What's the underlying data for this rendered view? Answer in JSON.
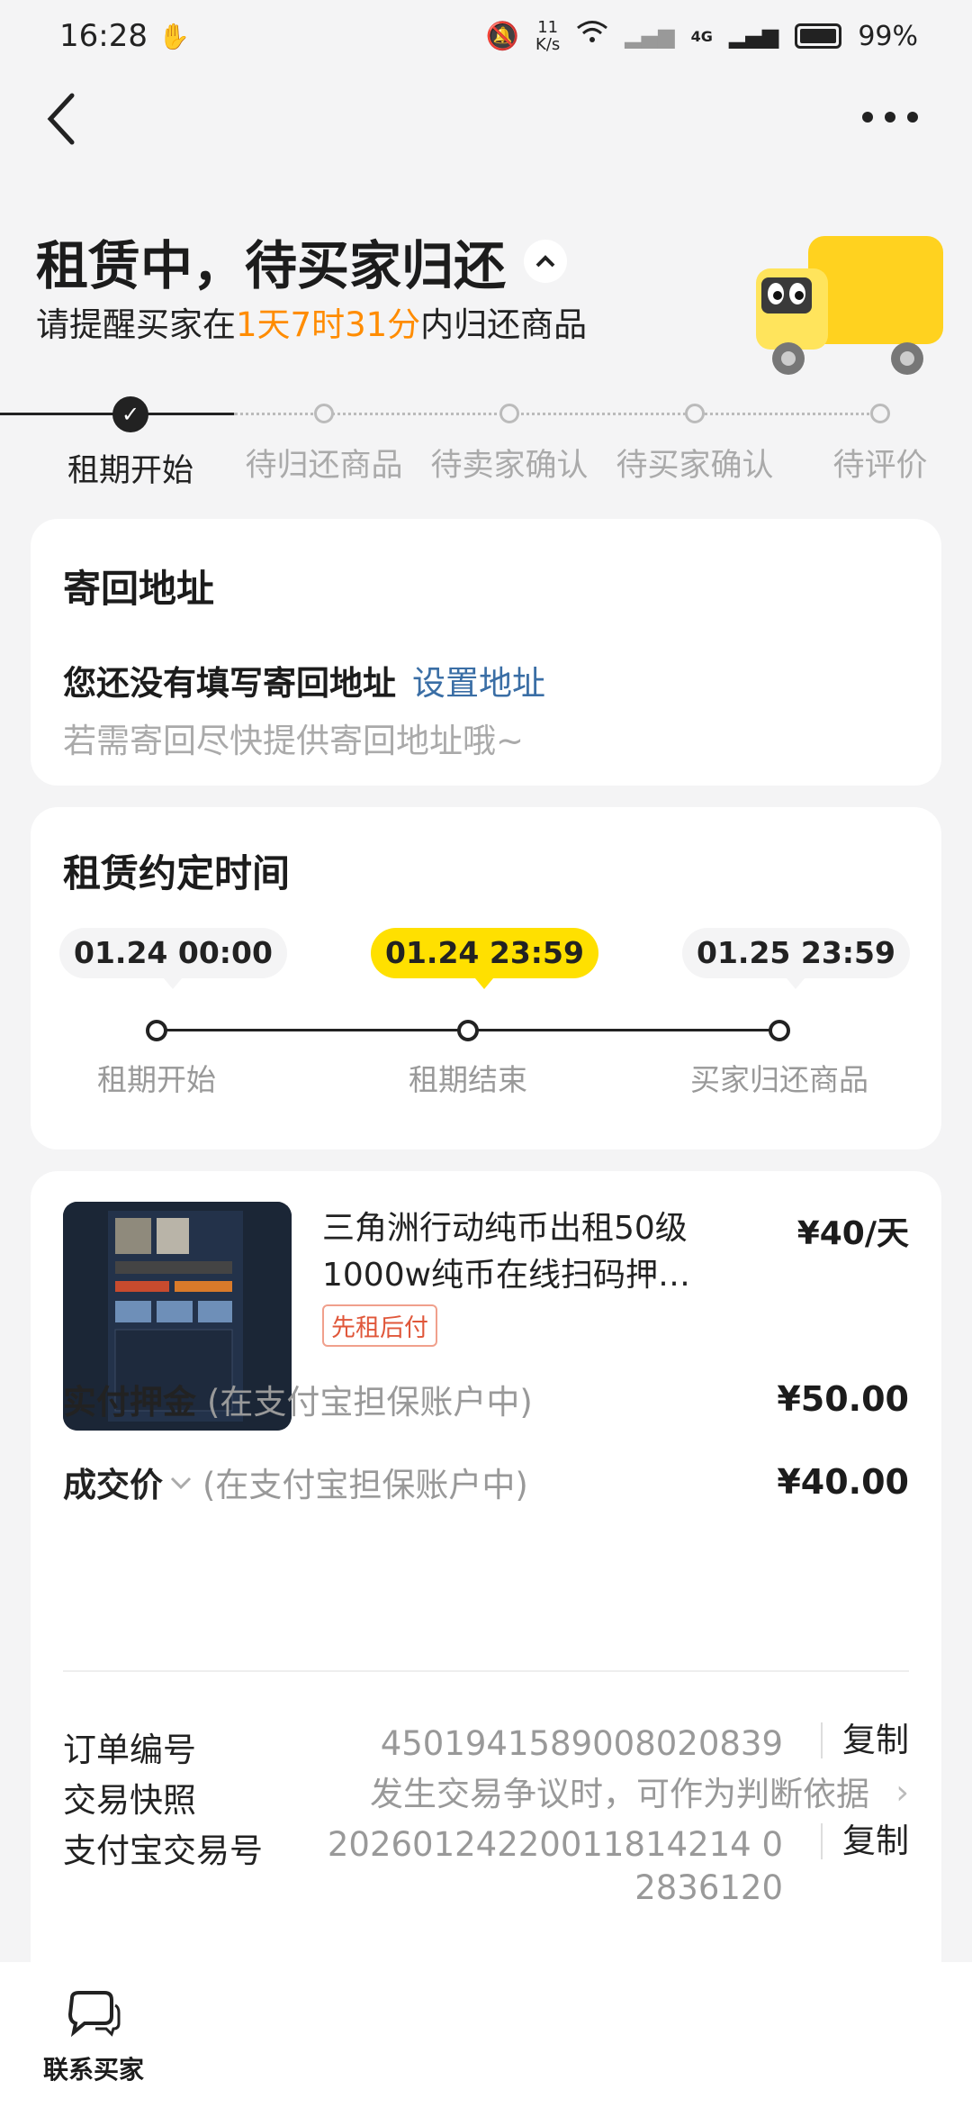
{
  "status_bar": {
    "time": "16:28",
    "net_speed": "11",
    "net_unit": "K/s",
    "network": "4G",
    "battery": "99%"
  },
  "header": {
    "title": "租赁中，待买家归还",
    "subtitle_prefix": "请提醒买家在",
    "subtitle_time": "1天7时31分",
    "subtitle_suffix": "内归还商品"
  },
  "steps": [
    "租期开始",
    "待归还商品",
    "待卖家确认",
    "待买家确认",
    "待评价"
  ],
  "address": {
    "title": "寄回地址",
    "missing": "您还没有填写寄回地址",
    "link": "设置地址",
    "hint": "若需寄回尽快提供寄回地址哦~"
  },
  "rental_time": {
    "title": "租赁约定时间",
    "points": [
      {
        "time": "01.24 00:00",
        "label": "租期开始"
      },
      {
        "time": "01.24 23:59",
        "label": "租期结束"
      },
      {
        "time": "01.25 23:59",
        "label": "买家归还商品"
      }
    ]
  },
  "product": {
    "title": "三角洲行动纯币出租50级1000w纯币在线扫码押…",
    "price": "¥40/天",
    "tag": "先租后付"
  },
  "payments": {
    "deposit_label": "实付押金",
    "deposit_note": "(在支付宝担保账户中)",
    "deposit_value": "¥50.00",
    "deal_label": "成交价",
    "deal_note": "(在支付宝担保账户中)",
    "deal_value": "¥40.00"
  },
  "details": {
    "order_no_label": "订单编号",
    "order_no": "4501941589008020839",
    "copy": "复制",
    "snapshot_label": "交易快照",
    "snapshot_value": "发生交易争议时，可作为判断依据",
    "alipay_label": "支付宝交易号",
    "alipay_no_line1": "20260124220011814214 0",
    "alipay_no_line2": "2836120"
  },
  "bottom": {
    "contact": "联系买家"
  },
  "colors": {
    "accent": "#ff8c00",
    "highlight": "#ffe000",
    "link": "#3a6ea5",
    "tag": "#e0573a"
  }
}
